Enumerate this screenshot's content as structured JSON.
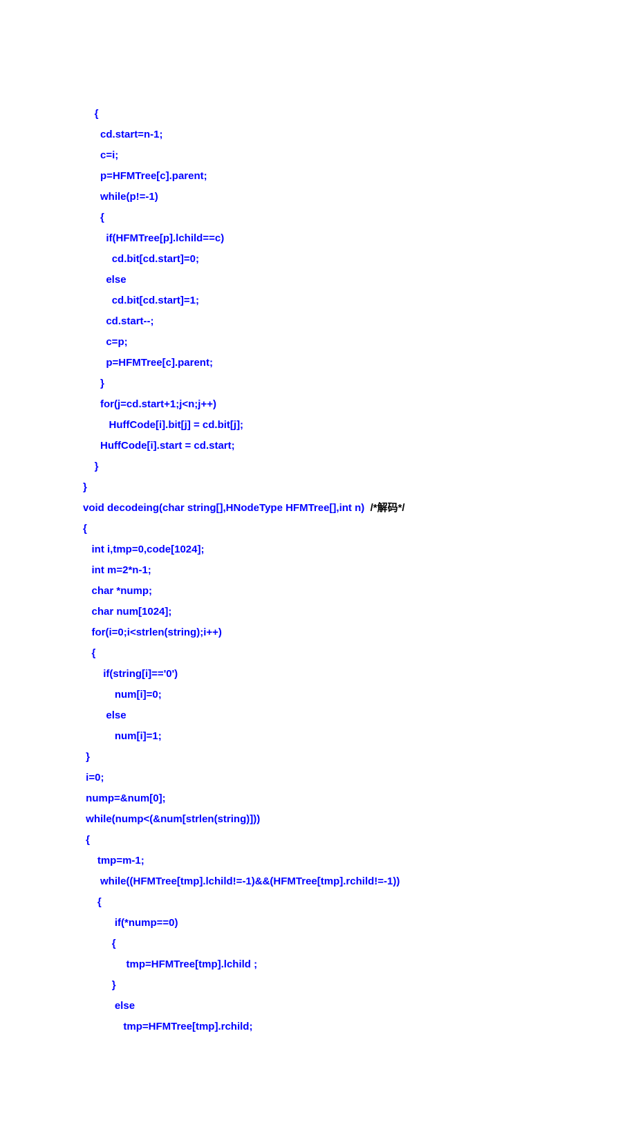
{
  "lines": [
    {
      "indent": 4,
      "segments": [
        {
          "t": "{"
        }
      ]
    },
    {
      "indent": 6,
      "segments": [
        {
          "t": "cd.start=n-1;"
        }
      ]
    },
    {
      "indent": 6,
      "segments": [
        {
          "t": "c=i;"
        }
      ]
    },
    {
      "indent": 6,
      "segments": [
        {
          "t": "p=HFMTree[c].parent;"
        }
      ]
    },
    {
      "indent": 6,
      "segments": [
        {
          "t": "while(p!=-1)"
        }
      ]
    },
    {
      "indent": 6,
      "segments": [
        {
          "t": "{"
        }
      ]
    },
    {
      "indent": 8,
      "segments": [
        {
          "t": "if(HFMTree[p].lchild==c)"
        }
      ]
    },
    {
      "indent": 10,
      "segments": [
        {
          "t": "cd.bit[cd.start]=0;"
        }
      ]
    },
    {
      "indent": 8,
      "segments": [
        {
          "t": "else"
        }
      ]
    },
    {
      "indent": 10,
      "segments": [
        {
          "t": "cd.bit[cd.start]=1;"
        }
      ]
    },
    {
      "indent": 8,
      "segments": [
        {
          "t": "cd.start--;"
        }
      ]
    },
    {
      "indent": 8,
      "segments": [
        {
          "t": "c=p;"
        }
      ]
    },
    {
      "indent": 8,
      "segments": [
        {
          "t": "p=HFMTree[c].parent;"
        }
      ]
    },
    {
      "indent": 6,
      "segments": [
        {
          "t": "}"
        }
      ]
    },
    {
      "indent": 6,
      "segments": [
        {
          "t": "for(j=cd.start+1;j<n;j++)"
        }
      ]
    },
    {
      "indent": 9,
      "segments": [
        {
          "t": "HuffCode[i].bit[j] = cd.bit[j];"
        }
      ]
    },
    {
      "indent": 6,
      "segments": [
        {
          "t": "HuffCode[i].start = cd.start;"
        }
      ]
    },
    {
      "indent": 4,
      "segments": [
        {
          "t": "}"
        }
      ]
    },
    {
      "indent": 0,
      "segments": [
        {
          "t": "}"
        }
      ]
    },
    {
      "indent": 0,
      "segments": [
        {
          "t": ""
        }
      ]
    },
    {
      "indent": 0,
      "segments": [
        {
          "t": "void decodeing(char string[],HNodeType HFMTree[],int n)  "
        },
        {
          "t": "/*解码*/",
          "cls": "comment"
        }
      ]
    },
    {
      "indent": 0,
      "segments": [
        {
          "t": "{"
        }
      ]
    },
    {
      "indent": 3,
      "segments": [
        {
          "t": "int i,tmp=0,code[1024];"
        }
      ]
    },
    {
      "indent": 3,
      "segments": [
        {
          "t": "int m=2*n-1;"
        }
      ]
    },
    {
      "indent": 3,
      "segments": [
        {
          "t": "char *nump;"
        }
      ]
    },
    {
      "indent": 3,
      "segments": [
        {
          "t": "char num[1024];"
        }
      ]
    },
    {
      "indent": 3,
      "segments": [
        {
          "t": "for(i=0;i<strlen(string);i++)"
        }
      ]
    },
    {
      "indent": 3,
      "segments": [
        {
          "t": "{"
        }
      ]
    },
    {
      "indent": 7,
      "segments": [
        {
          "t": "if(string[i]=='0')"
        }
      ]
    },
    {
      "indent": 11,
      "segments": [
        {
          "t": "num[i]=0;"
        }
      ]
    },
    {
      "indent": 7,
      "segments": [
        {
          "t": " else"
        }
      ]
    },
    {
      "indent": 11,
      "segments": [
        {
          "t": "num[i]=1;"
        }
      ]
    },
    {
      "indent": 1,
      "segments": [
        {
          "t": "}"
        }
      ]
    },
    {
      "indent": 1,
      "segments": [
        {
          "t": "i=0;"
        }
      ]
    },
    {
      "indent": 1,
      "segments": [
        {
          "t": "nump=&num[0];"
        }
      ]
    },
    {
      "indent": 1,
      "segments": [
        {
          "t": "while(nump<(&num[strlen(string)]))"
        }
      ]
    },
    {
      "indent": 1,
      "segments": [
        {
          "t": "{"
        }
      ]
    },
    {
      "indent": 5,
      "segments": [
        {
          "t": "tmp=m-1;"
        }
      ]
    },
    {
      "indent": 6,
      "segments": [
        {
          "t": "while((HFMTree[tmp].lchild!=-1)&&(HFMTree[tmp].rchild!=-1))"
        }
      ]
    },
    {
      "indent": 5,
      "segments": [
        {
          "t": "{"
        }
      ]
    },
    {
      "indent": 11,
      "segments": [
        {
          "t": "if(*nump==0)"
        }
      ]
    },
    {
      "indent": 10,
      "segments": [
        {
          "t": "{"
        }
      ]
    },
    {
      "indent": 15,
      "segments": [
        {
          "t": "tmp=HFMTree[tmp].lchild ;"
        }
      ]
    },
    {
      "indent": 10,
      "segments": [
        {
          "t": "}"
        }
      ]
    },
    {
      "indent": 11,
      "segments": [
        {
          "t": "else"
        }
      ]
    },
    {
      "indent": 14,
      "segments": [
        {
          "t": "tmp=HFMTree[tmp].rchild;"
        }
      ]
    }
  ]
}
